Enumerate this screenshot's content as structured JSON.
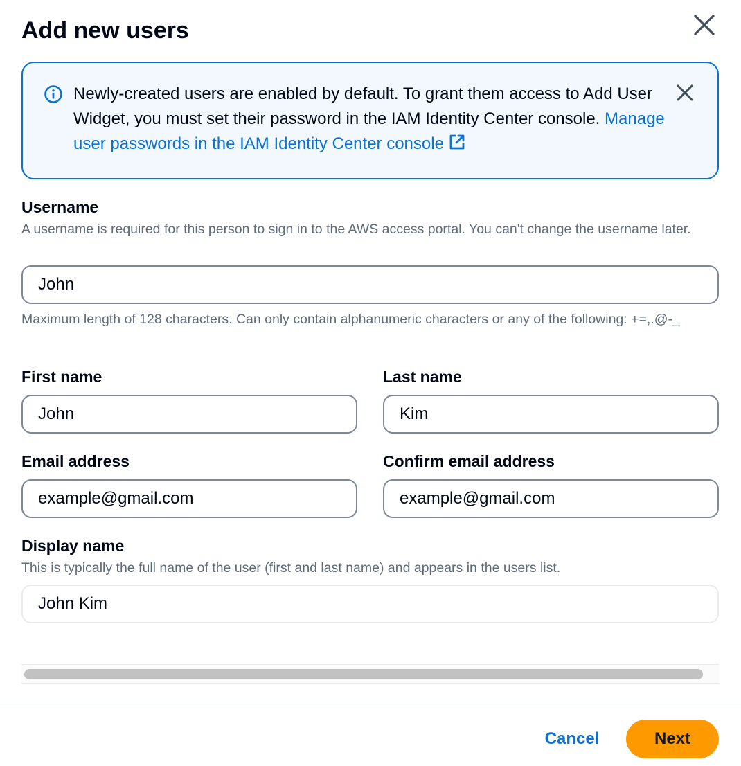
{
  "modal": {
    "title": "Add new users"
  },
  "alert": {
    "type": "info",
    "text": "Newly-created users are enabled by default. To grant them access to Add User Widget, you must set their password in the IAM Identity Center console.",
    "link_text": "Manage user passwords in the IAM Identity Center console",
    "icon": "info-circle-icon",
    "link_icon": "external-link-icon"
  },
  "form": {
    "username": {
      "label": "Username",
      "description": "A username is required for this person to sign in to the AWS access portal. You can't change the username later.",
      "value": "John",
      "constraint": "Maximum length of 128 characters. Can only contain alphanumeric characters or any of the following: +=,.@-_"
    },
    "first_name": {
      "label": "First name",
      "value": "John"
    },
    "last_name": {
      "label": "Last name",
      "value": "Kim"
    },
    "email": {
      "label": "Email address",
      "value": "example@gmail.com"
    },
    "confirm_email": {
      "label": "Confirm email address",
      "value": "example@gmail.com"
    },
    "display_name": {
      "label": "Display name",
      "description": "This is typically the full name of the user (first and last name) and appears in the users list.",
      "value": "John Kim"
    }
  },
  "footer": {
    "cancel_label": "Cancel",
    "next_label": "Next"
  },
  "colors": {
    "primary_button": "#ff9900",
    "link": "#0972d3",
    "alert_border": "#0972d3",
    "alert_background": "#f2f8fd",
    "input_border": "#7d8998",
    "muted_text": "#5f6b7a"
  }
}
